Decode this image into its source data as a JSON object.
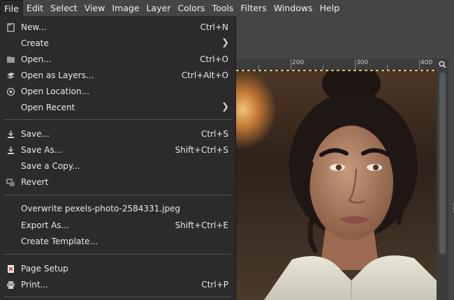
{
  "menubar": {
    "items": [
      "File",
      "Edit",
      "Select",
      "View",
      "Image",
      "Layer",
      "Colors",
      "Tools",
      "Filters",
      "Windows",
      "Help"
    ]
  },
  "file_menu": {
    "groups": [
      [
        {
          "label": "New...",
          "accel": "Ctrl+N",
          "icon": "new-document-icon"
        },
        {
          "label": "Create",
          "submenu": true
        },
        {
          "label": "Open...",
          "accel": "Ctrl+O",
          "icon": "open-folder-icon"
        },
        {
          "label": "Open as Layers...",
          "accel": "Ctrl+Alt+O",
          "icon": "open-layers-icon"
        },
        {
          "label": "Open Location...",
          "icon": "location-globe-icon"
        },
        {
          "label": "Open Recent",
          "submenu": true
        }
      ],
      [
        {
          "label": "Save...",
          "accel": "Ctrl+S",
          "icon": "save-icon"
        },
        {
          "label": "Save As...",
          "accel": "Shift+Ctrl+S",
          "icon": "save-as-icon"
        },
        {
          "label": "Save a Copy..."
        },
        {
          "label": "Revert",
          "icon": "revert-icon"
        }
      ],
      [
        {
          "label": "Overwrite pexels-photo-2584331.jpeg"
        },
        {
          "label": "Export As...",
          "accel": "Shift+Ctrl+E"
        },
        {
          "label": "Create Template..."
        }
      ],
      [
        {
          "label": "Page Setup",
          "icon": "page-setup-icon"
        },
        {
          "label": "Print...",
          "accel": "Ctrl+P",
          "icon": "print-icon"
        }
      ]
    ]
  },
  "ruler": {
    "labels": [
      "200",
      "300",
      "400"
    ]
  },
  "colors": {
    "accent_selection": "#e8c35a",
    "menu_bg": "#2b2b2b",
    "ui_bg": "#454545"
  }
}
